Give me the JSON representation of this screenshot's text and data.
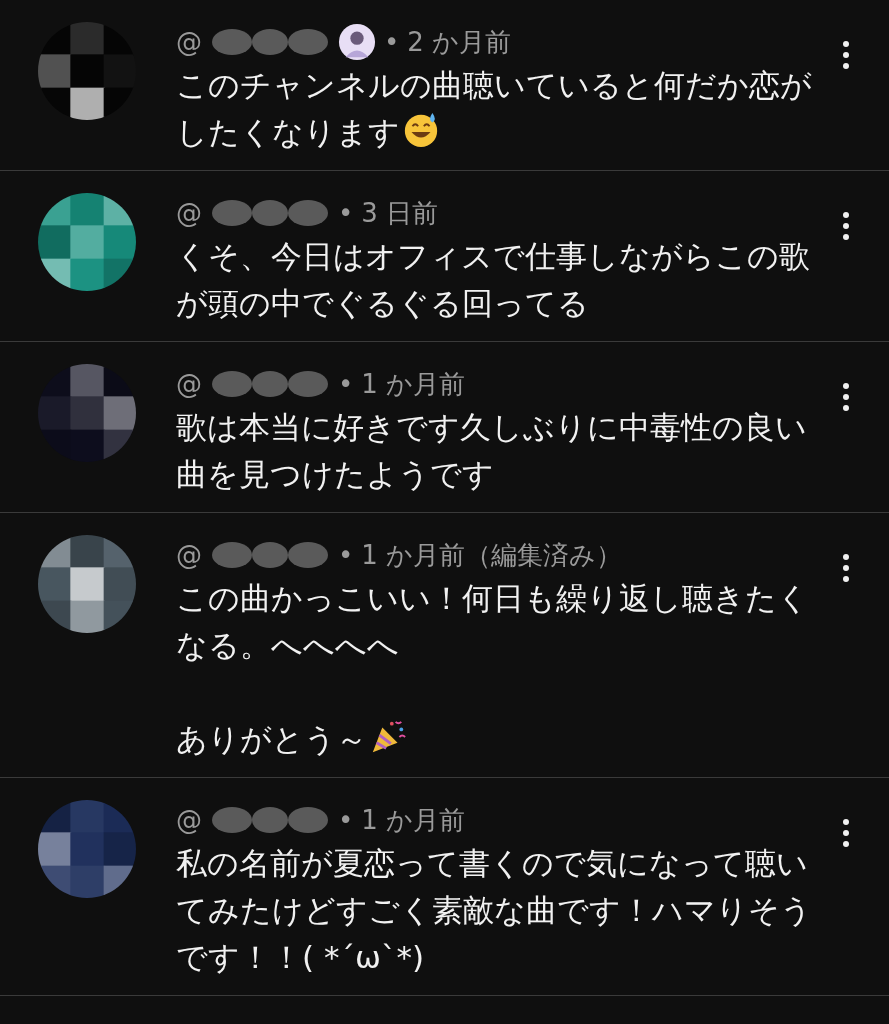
{
  "comments": [
    {
      "color": "#060606",
      "handle": "@",
      "has_badge": true,
      "separator": "•",
      "time": "2 か月前",
      "paragraphs": [
        {
          "text": "このチャンネルの曲聴いていると何だか恋がしたくなります",
          "kind": "sweat-smile"
        }
      ]
    },
    {
      "color": "#17907f",
      "handle": "@",
      "has_badge": false,
      "separator": "•",
      "time": "3 日前",
      "paragraphs": [
        {
          "text": "くそ、今日はオフィスで仕事しながらこの歌が頭の中でぐるぐる回ってる",
          "kind": "plain"
        }
      ]
    },
    {
      "color": "#0e0e1e",
      "handle": "@",
      "has_badge": false,
      "separator": "•",
      "time": "1 か月前",
      "paragraphs": [
        {
          "text": "歌は本当に好きです久しぶりに中毒性の良い曲を見つけたようです",
          "kind": "plain"
        }
      ]
    },
    {
      "color": "#4c5a64",
      "handle": "@",
      "has_badge": false,
      "separator": "•",
      "time": "1 か月前（編集済み）",
      "paragraphs": [
        {
          "text": "この曲かっこいい！何日も繰り返し聴きたくなる。へへへへ",
          "kind": "plain"
        },
        {
          "text": "ありがとう～",
          "kind": "party-popper"
        }
      ]
    },
    {
      "color": "#1c2d5a",
      "handle": "@",
      "has_badge": false,
      "separator": "•",
      "time": "1 か月前",
      "paragraphs": [
        {
          "text": "私の名前が夏恋って書くので気になって聴いてみたけどすごく素敵な曲です！ハマりそうです！！( *´ω`*)",
          "kind": "plain"
        }
      ]
    }
  ]
}
